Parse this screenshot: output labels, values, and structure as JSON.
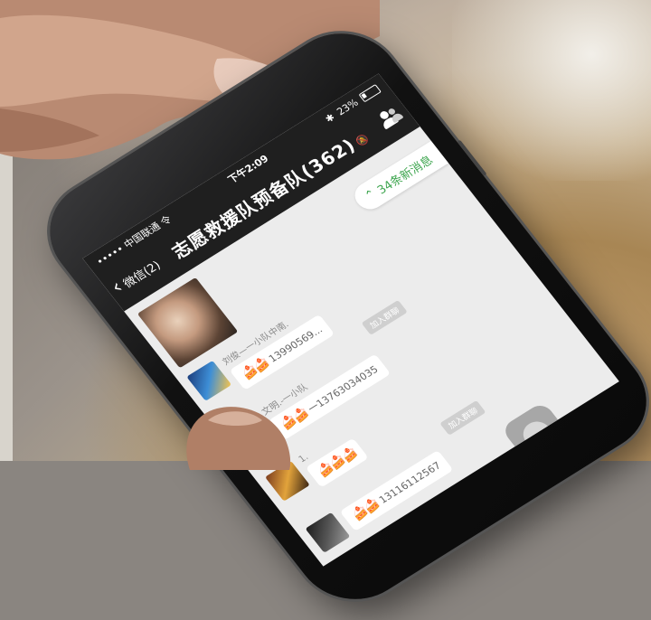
{
  "status_bar": {
    "carrier": "••••• 中国联通 令",
    "time": "下午2:09",
    "battery": "23%"
  },
  "nav": {
    "back_label": "微信(2)",
    "title": "志愿救援队预备队(362)",
    "title_icon": "mute-icon",
    "contacts_icon": "people-icon"
  },
  "new_messages": {
    "label": "34条新消息",
    "icon": "double-chevron-up-icon"
  },
  "messages": [
    {
      "sender": "刘俊—一小队中南.",
      "text": "13990569...",
      "emoji": "🍰🍰"
    },
    {
      "sender": "文明.-一小队",
      "text": "一13763034035",
      "emoji": "🍰🍰"
    },
    {
      "sender": "1.",
      "text": "",
      "emoji": "🍰🍰🍰"
    },
    {
      "sender": "",
      "text": "13116112567",
      "emoji": "🍰🍰"
    }
  ],
  "system_tags": [
    "加入群聊",
    "加入群聊"
  ],
  "colors": {
    "navbar": "#1f1f1f",
    "new_msg_text": "#3fa650",
    "chat_bg": "#ececec"
  }
}
